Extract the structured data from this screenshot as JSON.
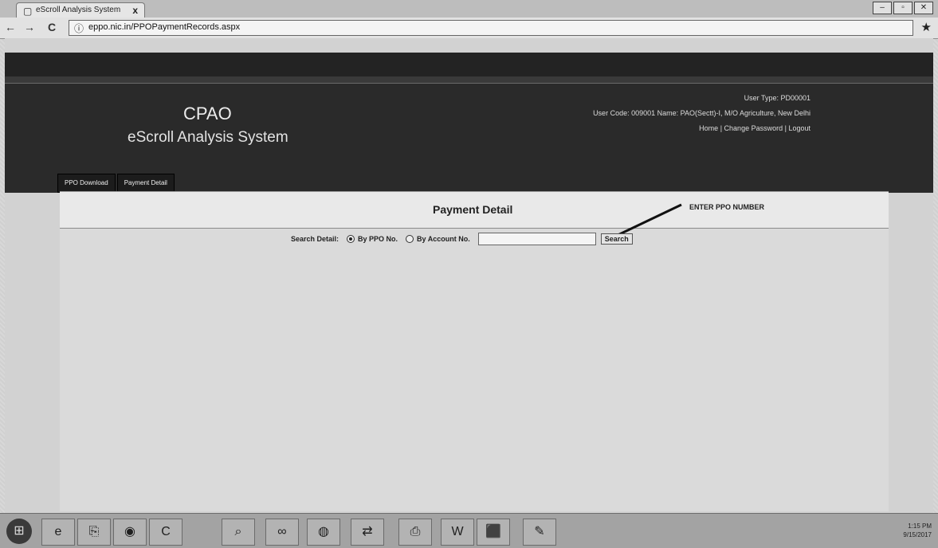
{
  "browser": {
    "tab_title": "eScroll Analysis System",
    "tab_close": "x",
    "url": "eppo.nic.in/PPOPaymentRecords.aspx",
    "back": "←",
    "forward": "→",
    "reload": "C",
    "star": "★",
    "window_controls": [
      "–",
      "▫",
      "✕"
    ]
  },
  "header": {
    "brand": "CPAO",
    "subtitle": "eScroll Analysis System",
    "user_type": "User Type: PD00001",
    "user_line": "User Code: 009001   Name: PAO(Sectt)-I, M/O Agriculture, New Delhi",
    "links": [
      "Home",
      "Change Password",
      "Logout"
    ],
    "link_sep": "|"
  },
  "menu": {
    "items": [
      "PPO Download",
      "Payment Detail"
    ]
  },
  "panel": {
    "title": "Payment Detail",
    "annotation": "ENTER PPO NUMBER",
    "search_label": "Search Detail:",
    "options": [
      "By PPO No.",
      "By Account No."
    ],
    "search_value": "",
    "search_button": "Search"
  },
  "taskbar": {
    "start": "⊞",
    "icons": [
      "e",
      "⎘",
      "◉",
      "C",
      "⌕",
      "∞",
      "◍",
      "⇄",
      "⎙",
      "W",
      "⬛",
      "✎"
    ],
    "tray_time": "1:15 PM",
    "tray_date": "9/15/2017"
  }
}
